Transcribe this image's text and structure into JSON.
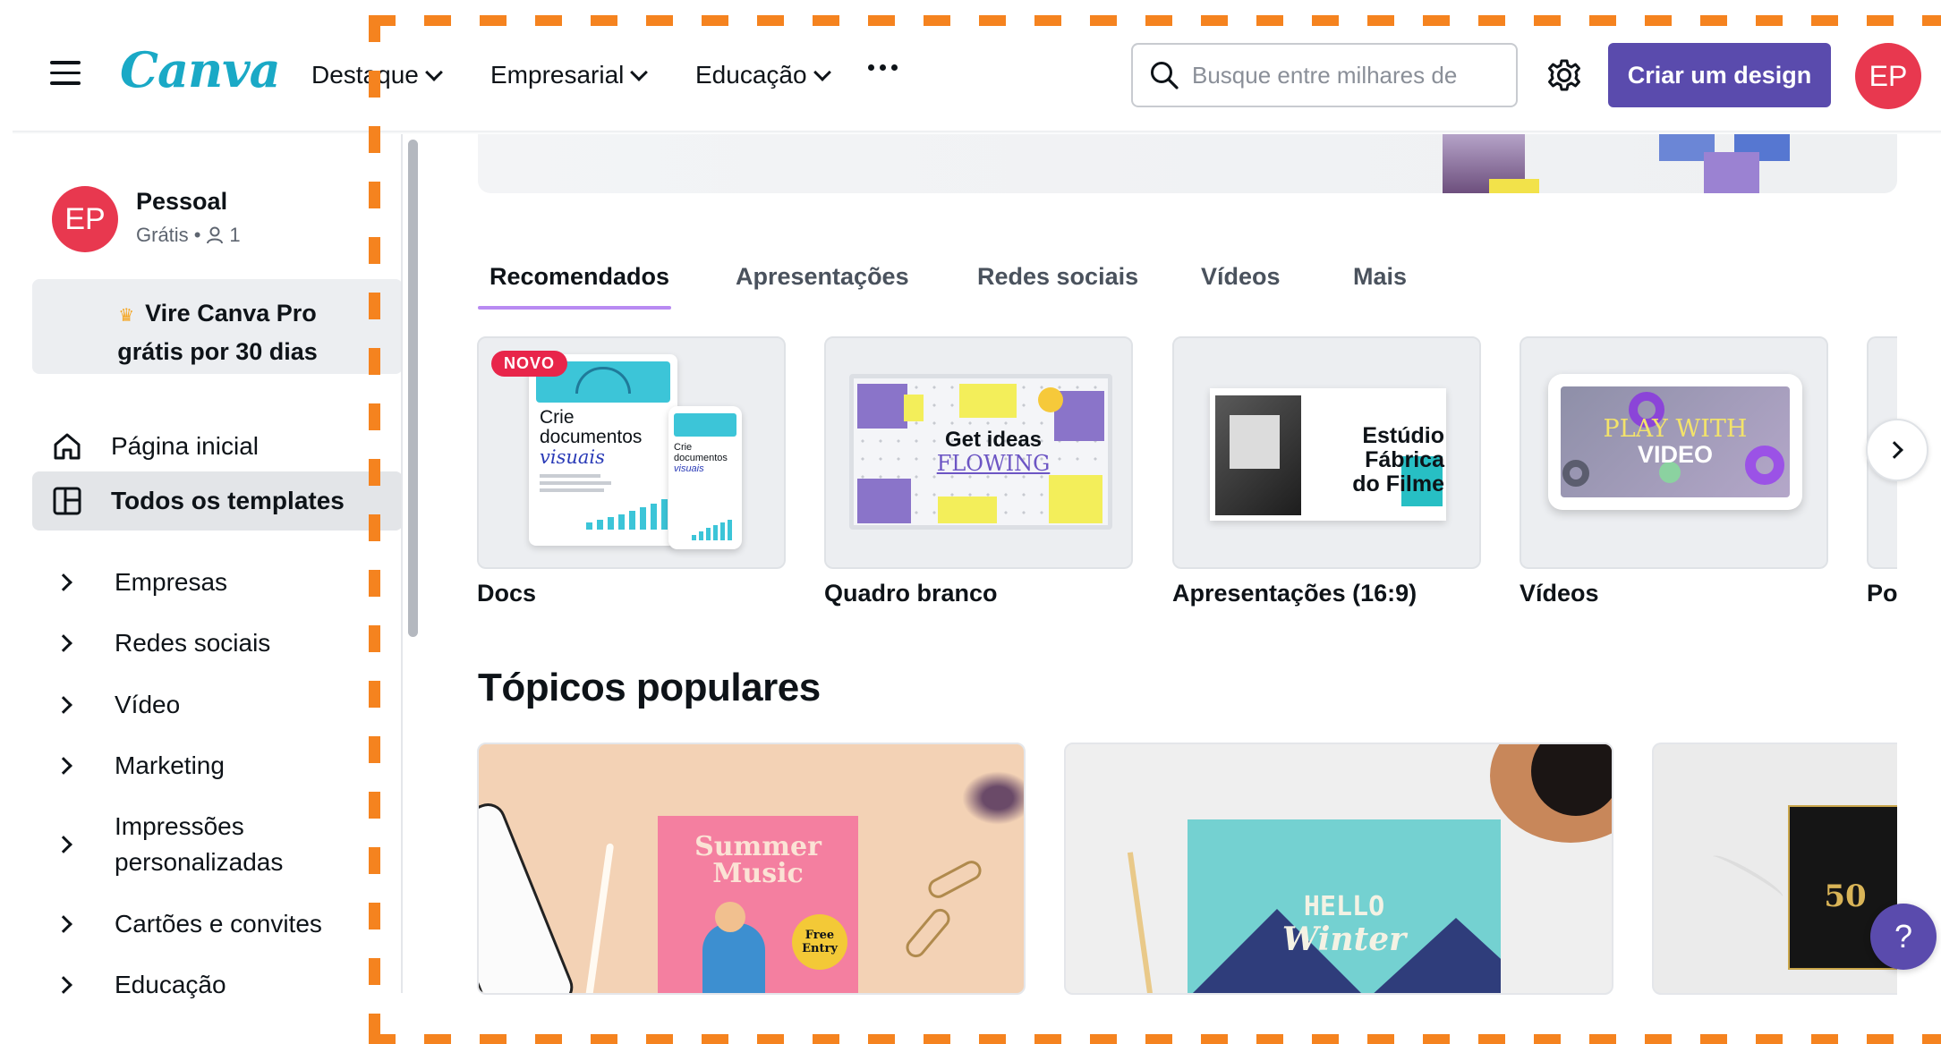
{
  "header": {
    "logo": "Canva",
    "nav": [
      {
        "label": "Destaque"
      },
      {
        "label": "Empresarial"
      },
      {
        "label": "Educação"
      }
    ],
    "more_icon": "more-horizontal-icon",
    "search_placeholder": "Busque entre milhares de templates",
    "create_button": "Criar um design",
    "avatar_initials": "EP"
  },
  "sidebar": {
    "profile": {
      "initials": "EP",
      "name": "Pessoal",
      "plan": "Grátis",
      "bullet": "•",
      "members": "1"
    },
    "pro_promo": {
      "line1": "Vire Canva Pro",
      "line2": "grátis por 30 dias",
      "icon": "crown-icon"
    },
    "items": [
      {
        "label": "Página inicial",
        "icon": "home-icon"
      },
      {
        "label": "Todos os templates",
        "icon": "templates-icon",
        "active": true
      },
      {
        "label": "Empresas"
      },
      {
        "label": "Redes sociais"
      },
      {
        "label": "Vídeo"
      },
      {
        "label": "Marketing"
      },
      {
        "label_line1": "Impressões",
        "label_line2": "personalizadas"
      },
      {
        "label": "Cartões e convites"
      },
      {
        "label": "Educação"
      }
    ]
  },
  "main": {
    "tabs": [
      {
        "label": "Recomendados",
        "active": true
      },
      {
        "label": "Apresentações"
      },
      {
        "label": "Redes sociais"
      },
      {
        "label": "Vídeos"
      },
      {
        "label": "Mais"
      }
    ],
    "cards": [
      {
        "label": "Docs",
        "badge": "NOVO",
        "thumb_line1": "Crie",
        "thumb_line2": "documentos",
        "thumb_line3": "visuais",
        "thumb_small1": "Crie",
        "thumb_small2": "documentos",
        "thumb_small3": "visuais"
      },
      {
        "label": "Quadro branco",
        "thumb_line1": "Get ideas",
        "thumb_line2": "FLOWING"
      },
      {
        "label": "Apresentações (16:9)",
        "thumb_line1": "Estúdio",
        "thumb_line2": "Fábrica",
        "thumb_line3": "do Filme"
      },
      {
        "label": "Vídeos",
        "thumb_line1": "PLAY WITH",
        "thumb_line2": "VIDEO"
      },
      {
        "label": "Po"
      }
    ],
    "section_title": "Tópicos populares",
    "topics": [
      {
        "thumb_line1": "Summer",
        "thumb_line2": "Music",
        "badge1": "Free",
        "badge2": "Entry"
      },
      {
        "thumb_line1": "HELLO",
        "thumb_line2": "Winter"
      },
      {
        "thumb_number": "50"
      }
    ],
    "help": "?"
  },
  "colors": {
    "brand": "#5a4bad",
    "avatar": "#e8384f",
    "logo": "#1aa9c6",
    "selection_dash": "#f5831f"
  }
}
